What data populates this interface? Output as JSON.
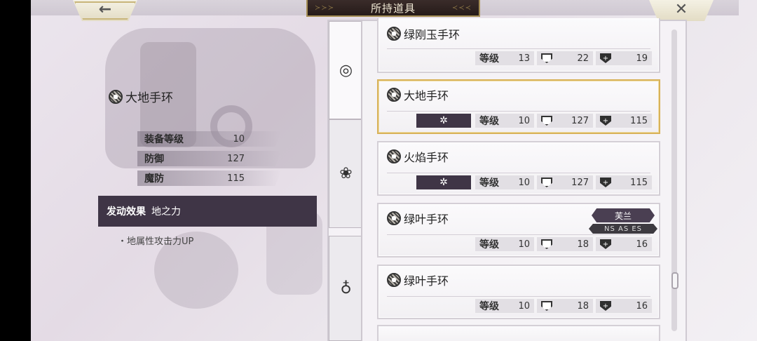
{
  "header": {
    "title": "所持道具",
    "back_glyph": "←",
    "close_glyph": "✕"
  },
  "detail": {
    "item_name": "大地手环",
    "icon": "bracelet-icon",
    "stats": [
      {
        "label": "装备等级",
        "value": "10"
      },
      {
        "label": "防御",
        "value": "127"
      },
      {
        "label": "魔防",
        "value": "115"
      }
    ],
    "effect_heading": "发动效果",
    "effect_name": "地之力",
    "effect_desc": "・地属性攻击力UP"
  },
  "tabs": [
    {
      "name": "bracelet-tab",
      "icon": "bracelet-icon",
      "glyph": "◎"
    },
    {
      "name": "amulet-tab",
      "icon": "amulet-icon",
      "glyph": "❀"
    },
    {
      "name": "ring-tab",
      "icon": "ring-icon",
      "glyph": "♁"
    }
  ],
  "list": {
    "level_label": "等级",
    "items": [
      {
        "name": "绿刚玉手环",
        "level": "13",
        "def": "22",
        "mdef": "19",
        "element": "",
        "character": "",
        "series": ""
      },
      {
        "name": "大地手环",
        "level": "10",
        "def": "127",
        "mdef": "115",
        "element": "✲",
        "character": "",
        "series": ""
      },
      {
        "name": "火焰手环",
        "level": "10",
        "def": "127",
        "mdef": "115",
        "element": "✲",
        "character": "",
        "series": ""
      },
      {
        "name": "绿叶手环",
        "level": "10",
        "def": "18",
        "mdef": "16",
        "element": "",
        "character": "芙兰",
        "series": "NS AS ES"
      },
      {
        "name": "绿叶手环",
        "level": "10",
        "def": "18",
        "mdef": "16",
        "element": "",
        "character": "",
        "series": ""
      }
    ]
  },
  "colors": {
    "selected_border": "#d8b25a",
    "dark_plate": "#3f3546",
    "title_plate": "#2f2321"
  }
}
